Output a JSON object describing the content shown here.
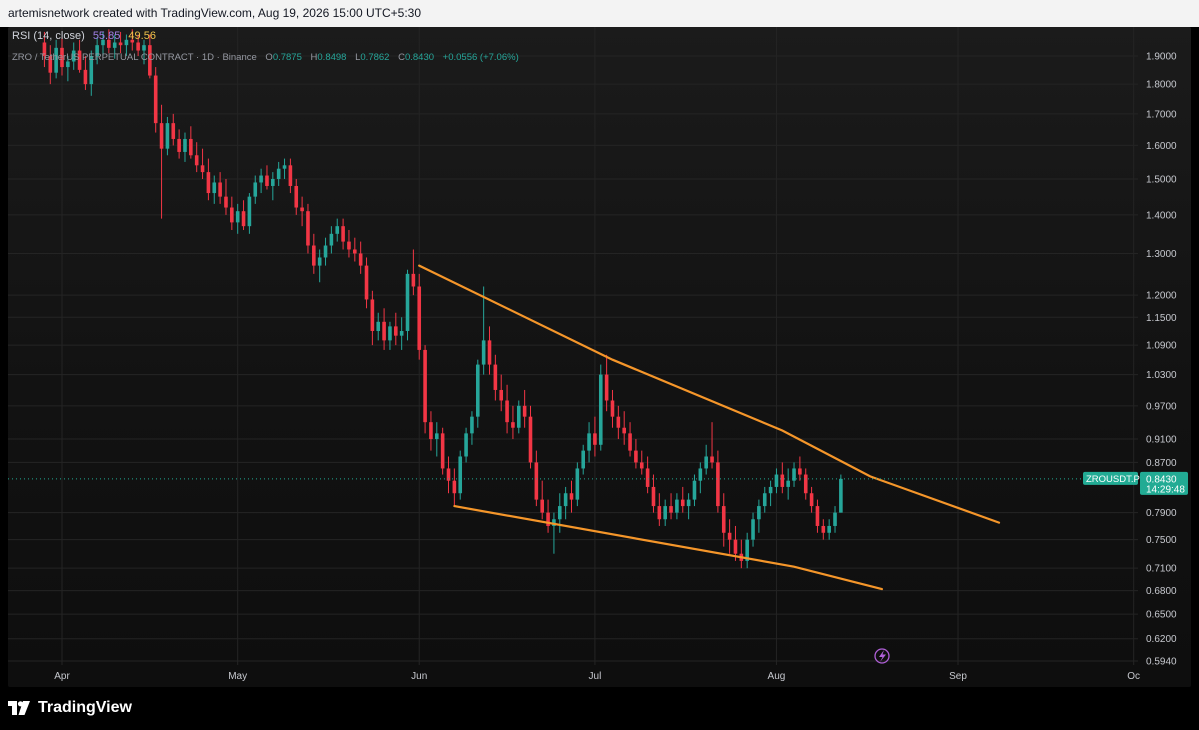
{
  "header": {
    "attribution": "artemisnetwork created with TradingView.com, Aug 19, 2026 15:00 UTC+5:30"
  },
  "indicator": {
    "label": "RSI (14, close)",
    "value1": "55.85",
    "value2": "49.56",
    "value1_color": "#a080e6",
    "value2_color": "#f0c34a"
  },
  "legend": {
    "symbol": "ZRO / TetherUS PERPETUAL CONTRACT · 1D · Binance",
    "open_label": "O",
    "open_value": "0.7875",
    "high_label": "H",
    "high_value": "0.8498",
    "low_label": "L",
    "low_value": "0.7862",
    "close_label": "C",
    "close_value": "0.8430",
    "change_value": "+0.0556 (+7.06%)"
  },
  "price_tag": {
    "ticker": "ZROUSDT.P",
    "price": "0.8430",
    "countdown": "14:29:48",
    "color": "#22ab94"
  },
  "footer": {
    "brand": "TradingView"
  },
  "colors": {
    "up": "#26a69a",
    "down": "#f23645",
    "trendline": "#f5962a",
    "background": "#000000",
    "panel": "#171717"
  },
  "chart_data": {
    "type": "candlestick",
    "y_scale": "log",
    "ylim": [
      0.594,
      1.95
    ],
    "y_ticks": [
      "1.9000",
      "1.8000",
      "1.7000",
      "1.6000",
      "1.5000",
      "1.4000",
      "1.3000",
      "1.2000",
      "1.1500",
      "1.0900",
      "1.0300",
      "0.9700",
      "0.9100",
      "0.8700",
      "0.7900",
      "0.7500",
      "0.7100",
      "0.6800",
      "0.6500",
      "0.6200",
      "0.5940"
    ],
    "x_ticks": [
      {
        "label": "Apr",
        "day": 0
      },
      {
        "label": "May",
        "day": 30
      },
      {
        "label": "Jun",
        "day": 61
      },
      {
        "label": "Jul",
        "day": 91
      },
      {
        "label": "Aug",
        "day": 122
      },
      {
        "label": "Sep",
        "day": 153
      },
      {
        "label": "Oc",
        "day": 183
      }
    ],
    "start_date": "2026-04-01",
    "trendlines": [
      {
        "name": "resistance",
        "points": [
          [
            61,
            1.27
          ],
          [
            94,
            1.06
          ],
          [
            123,
            0.925
          ],
          [
            138,
            0.847
          ],
          [
            160,
            0.775
          ]
        ]
      },
      {
        "name": "falling-support",
        "points": [
          [
            67,
            0.8
          ],
          [
            125,
            0.712
          ],
          [
            140,
            0.682
          ]
        ]
      }
    ],
    "candles": [
      {
        "d": -3,
        "o": 1.95,
        "h": 1.99,
        "l": 1.86,
        "c": 1.9
      },
      {
        "d": -2,
        "o": 1.9,
        "h": 1.94,
        "l": 1.8,
        "c": 1.84
      },
      {
        "d": -1,
        "o": 1.84,
        "h": 1.96,
        "l": 1.82,
        "c": 1.93
      },
      {
        "d": 0,
        "o": 1.93,
        "h": 1.97,
        "l": 1.83,
        "c": 1.86
      },
      {
        "d": 1,
        "o": 1.86,
        "h": 1.9,
        "l": 1.81,
        "c": 1.88
      },
      {
        "d": 2,
        "o": 1.88,
        "h": 1.95,
        "l": 1.85,
        "c": 1.92
      },
      {
        "d": 3,
        "o": 1.92,
        "h": 1.96,
        "l": 1.84,
        "c": 1.85
      },
      {
        "d": 4,
        "o": 1.85,
        "h": 1.9,
        "l": 1.78,
        "c": 1.8
      },
      {
        "d": 5,
        "o": 1.8,
        "h": 1.92,
        "l": 1.76,
        "c": 1.9
      },
      {
        "d": 6,
        "o": 1.9,
        "h": 1.97,
        "l": 1.87,
        "c": 1.94
      },
      {
        "d": 7,
        "o": 1.94,
        "h": 1.99,
        "l": 1.9,
        "c": 1.96
      },
      {
        "d": 8,
        "o": 1.96,
        "h": 2.0,
        "l": 1.91,
        "c": 1.93
      },
      {
        "d": 9,
        "o": 1.93,
        "h": 1.98,
        "l": 1.89,
        "c": 1.95
      },
      {
        "d": 10,
        "o": 1.95,
        "h": 1.99,
        "l": 1.91,
        "c": 1.94
      },
      {
        "d": 11,
        "o": 1.94,
        "h": 1.98,
        "l": 1.9,
        "c": 1.96
      },
      {
        "d": 12,
        "o": 1.96,
        "h": 2.0,
        "l": 1.92,
        "c": 1.95
      },
      {
        "d": 13,
        "o": 1.95,
        "h": 1.98,
        "l": 1.9,
        "c": 1.92
      },
      {
        "d": 14,
        "o": 1.92,
        "h": 1.96,
        "l": 1.87,
        "c": 1.94
      },
      {
        "d": 15,
        "o": 1.94,
        "h": 1.98,
        "l": 1.82,
        "c": 1.83
      },
      {
        "d": 16,
        "o": 1.83,
        "h": 1.86,
        "l": 1.64,
        "c": 1.67
      },
      {
        "d": 17,
        "o": 1.67,
        "h": 1.73,
        "l": 1.39,
        "c": 1.59
      },
      {
        "d": 18,
        "o": 1.59,
        "h": 1.69,
        "l": 1.57,
        "c": 1.67
      },
      {
        "d": 19,
        "o": 1.67,
        "h": 1.7,
        "l": 1.6,
        "c": 1.62
      },
      {
        "d": 20,
        "o": 1.62,
        "h": 1.65,
        "l": 1.56,
        "c": 1.58
      },
      {
        "d": 21,
        "o": 1.58,
        "h": 1.64,
        "l": 1.55,
        "c": 1.62
      },
      {
        "d": 22,
        "o": 1.62,
        "h": 1.66,
        "l": 1.56,
        "c": 1.57
      },
      {
        "d": 23,
        "o": 1.57,
        "h": 1.61,
        "l": 1.52,
        "c": 1.54
      },
      {
        "d": 24,
        "o": 1.54,
        "h": 1.59,
        "l": 1.5,
        "c": 1.52
      },
      {
        "d": 25,
        "o": 1.52,
        "h": 1.56,
        "l": 1.44,
        "c": 1.46
      },
      {
        "d": 26,
        "o": 1.46,
        "h": 1.51,
        "l": 1.43,
        "c": 1.49
      },
      {
        "d": 27,
        "o": 1.49,
        "h": 1.52,
        "l": 1.43,
        "c": 1.45
      },
      {
        "d": 28,
        "o": 1.45,
        "h": 1.5,
        "l": 1.4,
        "c": 1.42
      },
      {
        "d": 29,
        "o": 1.42,
        "h": 1.45,
        "l": 1.36,
        "c": 1.38
      },
      {
        "d": 30,
        "o": 1.38,
        "h": 1.43,
        "l": 1.35,
        "c": 1.41
      },
      {
        "d": 31,
        "o": 1.41,
        "h": 1.44,
        "l": 1.36,
        "c": 1.37
      },
      {
        "d": 32,
        "o": 1.37,
        "h": 1.46,
        "l": 1.35,
        "c": 1.45
      },
      {
        "d": 33,
        "o": 1.45,
        "h": 1.51,
        "l": 1.43,
        "c": 1.49
      },
      {
        "d": 34,
        "o": 1.49,
        "h": 1.53,
        "l": 1.46,
        "c": 1.51
      },
      {
        "d": 35,
        "o": 1.51,
        "h": 1.54,
        "l": 1.47,
        "c": 1.48
      },
      {
        "d": 36,
        "o": 1.48,
        "h": 1.52,
        "l": 1.44,
        "c": 1.5
      },
      {
        "d": 37,
        "o": 1.5,
        "h": 1.55,
        "l": 1.48,
        "c": 1.53
      },
      {
        "d": 38,
        "o": 1.53,
        "h": 1.56,
        "l": 1.5,
        "c": 1.54
      },
      {
        "d": 39,
        "o": 1.54,
        "h": 1.56,
        "l": 1.46,
        "c": 1.48
      },
      {
        "d": 40,
        "o": 1.48,
        "h": 1.5,
        "l": 1.4,
        "c": 1.42
      },
      {
        "d": 41,
        "o": 1.42,
        "h": 1.45,
        "l": 1.37,
        "c": 1.41
      },
      {
        "d": 42,
        "o": 1.41,
        "h": 1.43,
        "l": 1.3,
        "c": 1.32
      },
      {
        "d": 43,
        "o": 1.32,
        "h": 1.35,
        "l": 1.25,
        "c": 1.27
      },
      {
        "d": 44,
        "o": 1.27,
        "h": 1.31,
        "l": 1.23,
        "c": 1.29
      },
      {
        "d": 45,
        "o": 1.29,
        "h": 1.34,
        "l": 1.27,
        "c": 1.32
      },
      {
        "d": 46,
        "o": 1.32,
        "h": 1.37,
        "l": 1.3,
        "c": 1.35
      },
      {
        "d": 47,
        "o": 1.35,
        "h": 1.39,
        "l": 1.33,
        "c": 1.37
      },
      {
        "d": 48,
        "o": 1.37,
        "h": 1.39,
        "l": 1.31,
        "c": 1.33
      },
      {
        "d": 49,
        "o": 1.33,
        "h": 1.36,
        "l": 1.29,
        "c": 1.31
      },
      {
        "d": 50,
        "o": 1.31,
        "h": 1.34,
        "l": 1.28,
        "c": 1.3
      },
      {
        "d": 51,
        "o": 1.3,
        "h": 1.33,
        "l": 1.25,
        "c": 1.27
      },
      {
        "d": 52,
        "o": 1.27,
        "h": 1.29,
        "l": 1.17,
        "c": 1.19
      },
      {
        "d": 53,
        "o": 1.19,
        "h": 1.21,
        "l": 1.09,
        "c": 1.12
      },
      {
        "d": 54,
        "o": 1.12,
        "h": 1.16,
        "l": 1.1,
        "c": 1.14
      },
      {
        "d": 55,
        "o": 1.14,
        "h": 1.17,
        "l": 1.08,
        "c": 1.1
      },
      {
        "d": 56,
        "o": 1.1,
        "h": 1.14,
        "l": 1.08,
        "c": 1.13
      },
      {
        "d": 57,
        "o": 1.13,
        "h": 1.16,
        "l": 1.09,
        "c": 1.11
      },
      {
        "d": 58,
        "o": 1.11,
        "h": 1.15,
        "l": 1.08,
        "c": 1.12
      },
      {
        "d": 59,
        "o": 1.12,
        "h": 1.26,
        "l": 1.1,
        "c": 1.25
      },
      {
        "d": 60,
        "o": 1.25,
        "h": 1.31,
        "l": 1.2,
        "c": 1.22
      },
      {
        "d": 61,
        "o": 1.22,
        "h": 1.25,
        "l": 1.06,
        "c": 1.08
      },
      {
        "d": 62,
        "o": 1.08,
        "h": 1.09,
        "l": 0.92,
        "c": 0.94
      },
      {
        "d": 63,
        "o": 0.94,
        "h": 0.96,
        "l": 0.89,
        "c": 0.91
      },
      {
        "d": 64,
        "o": 0.91,
        "h": 0.94,
        "l": 0.88,
        "c": 0.92
      },
      {
        "d": 65,
        "o": 0.92,
        "h": 0.93,
        "l": 0.85,
        "c": 0.86
      },
      {
        "d": 66,
        "o": 0.86,
        "h": 0.88,
        "l": 0.82,
        "c": 0.84
      },
      {
        "d": 67,
        "o": 0.84,
        "h": 0.86,
        "l": 0.8,
        "c": 0.82
      },
      {
        "d": 68,
        "o": 0.82,
        "h": 0.89,
        "l": 0.81,
        "c": 0.88
      },
      {
        "d": 69,
        "o": 0.88,
        "h": 0.93,
        "l": 0.87,
        "c": 0.92
      },
      {
        "d": 70,
        "o": 0.92,
        "h": 0.96,
        "l": 0.9,
        "c": 0.95
      },
      {
        "d": 71,
        "o": 0.95,
        "h": 1.06,
        "l": 0.93,
        "c": 1.05
      },
      {
        "d": 72,
        "o": 1.05,
        "h": 1.22,
        "l": 1.03,
        "c": 1.1
      },
      {
        "d": 73,
        "o": 1.1,
        "h": 1.13,
        "l": 1.03,
        "c": 1.05
      },
      {
        "d": 74,
        "o": 1.05,
        "h": 1.07,
        "l": 0.98,
        "c": 1.0
      },
      {
        "d": 75,
        "o": 1.0,
        "h": 1.03,
        "l": 0.96,
        "c": 0.98
      },
      {
        "d": 76,
        "o": 0.98,
        "h": 1.01,
        "l": 0.92,
        "c": 0.94
      },
      {
        "d": 77,
        "o": 0.94,
        "h": 0.97,
        "l": 0.91,
        "c": 0.93
      },
      {
        "d": 78,
        "o": 0.93,
        "h": 0.98,
        "l": 0.92,
        "c": 0.97
      },
      {
        "d": 79,
        "o": 0.97,
        "h": 1.0,
        "l": 0.93,
        "c": 0.95
      },
      {
        "d": 80,
        "o": 0.95,
        "h": 0.97,
        "l": 0.86,
        "c": 0.87
      },
      {
        "d": 81,
        "o": 0.87,
        "h": 0.89,
        "l": 0.8,
        "c": 0.81
      },
      {
        "d": 82,
        "o": 0.81,
        "h": 0.84,
        "l": 0.78,
        "c": 0.79
      },
      {
        "d": 83,
        "o": 0.79,
        "h": 0.81,
        "l": 0.76,
        "c": 0.77
      },
      {
        "d": 84,
        "o": 0.77,
        "h": 0.79,
        "l": 0.73,
        "c": 0.78
      },
      {
        "d": 85,
        "o": 0.78,
        "h": 0.82,
        "l": 0.76,
        "c": 0.8
      },
      {
        "d": 86,
        "o": 0.8,
        "h": 0.83,
        "l": 0.78,
        "c": 0.82
      },
      {
        "d": 87,
        "o": 0.82,
        "h": 0.84,
        "l": 0.79,
        "c": 0.81
      },
      {
        "d": 88,
        "o": 0.81,
        "h": 0.87,
        "l": 0.8,
        "c": 0.86
      },
      {
        "d": 89,
        "o": 0.86,
        "h": 0.9,
        "l": 0.85,
        "c": 0.89
      },
      {
        "d": 90,
        "o": 0.89,
        "h": 0.94,
        "l": 0.87,
        "c": 0.92
      },
      {
        "d": 91,
        "o": 0.92,
        "h": 0.95,
        "l": 0.88,
        "c": 0.9
      },
      {
        "d": 92,
        "o": 0.9,
        "h": 1.05,
        "l": 0.89,
        "c": 1.03
      },
      {
        "d": 93,
        "o": 1.03,
        "h": 1.07,
        "l": 0.96,
        "c": 0.98
      },
      {
        "d": 94,
        "o": 0.98,
        "h": 1.0,
        "l": 0.93,
        "c": 0.95
      },
      {
        "d": 95,
        "o": 0.95,
        "h": 0.97,
        "l": 0.91,
        "c": 0.93
      },
      {
        "d": 96,
        "o": 0.93,
        "h": 0.96,
        "l": 0.9,
        "c": 0.92
      },
      {
        "d": 97,
        "o": 0.92,
        "h": 0.94,
        "l": 0.88,
        "c": 0.89
      },
      {
        "d": 98,
        "o": 0.89,
        "h": 0.91,
        "l": 0.86,
        "c": 0.87
      },
      {
        "d": 99,
        "o": 0.87,
        "h": 0.89,
        "l": 0.85,
        "c": 0.86
      },
      {
        "d": 100,
        "o": 0.86,
        "h": 0.88,
        "l": 0.82,
        "c": 0.83
      },
      {
        "d": 101,
        "o": 0.83,
        "h": 0.85,
        "l": 0.79,
        "c": 0.8
      },
      {
        "d": 102,
        "o": 0.8,
        "h": 0.82,
        "l": 0.77,
        "c": 0.78
      },
      {
        "d": 103,
        "o": 0.78,
        "h": 0.81,
        "l": 0.77,
        "c": 0.8
      },
      {
        "d": 104,
        "o": 0.8,
        "h": 0.82,
        "l": 0.78,
        "c": 0.79
      },
      {
        "d": 105,
        "o": 0.79,
        "h": 0.82,
        "l": 0.78,
        "c": 0.81
      },
      {
        "d": 106,
        "o": 0.81,
        "h": 0.83,
        "l": 0.79,
        "c": 0.8
      },
      {
        "d": 107,
        "o": 0.8,
        "h": 0.82,
        "l": 0.78,
        "c": 0.81
      },
      {
        "d": 108,
        "o": 0.81,
        "h": 0.85,
        "l": 0.8,
        "c": 0.84
      },
      {
        "d": 109,
        "o": 0.84,
        "h": 0.87,
        "l": 0.82,
        "c": 0.86
      },
      {
        "d": 110,
        "o": 0.86,
        "h": 0.9,
        "l": 0.85,
        "c": 0.88
      },
      {
        "d": 111,
        "o": 0.88,
        "h": 0.94,
        "l": 0.86,
        "c": 0.87
      },
      {
        "d": 112,
        "o": 0.87,
        "h": 0.89,
        "l": 0.79,
        "c": 0.8
      },
      {
        "d": 113,
        "o": 0.8,
        "h": 0.82,
        "l": 0.74,
        "c": 0.76
      },
      {
        "d": 114,
        "o": 0.76,
        "h": 0.78,
        "l": 0.73,
        "c": 0.75
      },
      {
        "d": 115,
        "o": 0.75,
        "h": 0.77,
        "l": 0.72,
        "c": 0.73
      },
      {
        "d": 116,
        "o": 0.73,
        "h": 0.75,
        "l": 0.71,
        "c": 0.72
      },
      {
        "d": 117,
        "o": 0.72,
        "h": 0.76,
        "l": 0.71,
        "c": 0.75
      },
      {
        "d": 118,
        "o": 0.75,
        "h": 0.79,
        "l": 0.74,
        "c": 0.78
      },
      {
        "d": 119,
        "o": 0.78,
        "h": 0.81,
        "l": 0.76,
        "c": 0.8
      },
      {
        "d": 120,
        "o": 0.8,
        "h": 0.83,
        "l": 0.79,
        "c": 0.82
      },
      {
        "d": 121,
        "o": 0.82,
        "h": 0.84,
        "l": 0.8,
        "c": 0.83
      },
      {
        "d": 122,
        "o": 0.83,
        "h": 0.86,
        "l": 0.82,
        "c": 0.85
      },
      {
        "d": 123,
        "o": 0.85,
        "h": 0.87,
        "l": 0.82,
        "c": 0.83
      },
      {
        "d": 124,
        "o": 0.83,
        "h": 0.86,
        "l": 0.81,
        "c": 0.84
      },
      {
        "d": 125,
        "o": 0.84,
        "h": 0.87,
        "l": 0.83,
        "c": 0.86
      },
      {
        "d": 126,
        "o": 0.86,
        "h": 0.88,
        "l": 0.84,
        "c": 0.85
      },
      {
        "d": 127,
        "o": 0.85,
        "h": 0.86,
        "l": 0.81,
        "c": 0.82
      },
      {
        "d": 128,
        "o": 0.82,
        "h": 0.83,
        "l": 0.79,
        "c": 0.8
      },
      {
        "d": 129,
        "o": 0.8,
        "h": 0.81,
        "l": 0.76,
        "c": 0.77
      },
      {
        "d": 130,
        "o": 0.77,
        "h": 0.78,
        "l": 0.75,
        "c": 0.76
      },
      {
        "d": 131,
        "o": 0.76,
        "h": 0.78,
        "l": 0.75,
        "c": 0.77
      },
      {
        "d": 132,
        "o": 0.77,
        "h": 0.8,
        "l": 0.76,
        "c": 0.79
      },
      {
        "d": 133,
        "o": 0.79,
        "h": 0.85,
        "l": 0.79,
        "c": 0.843
      }
    ]
  }
}
